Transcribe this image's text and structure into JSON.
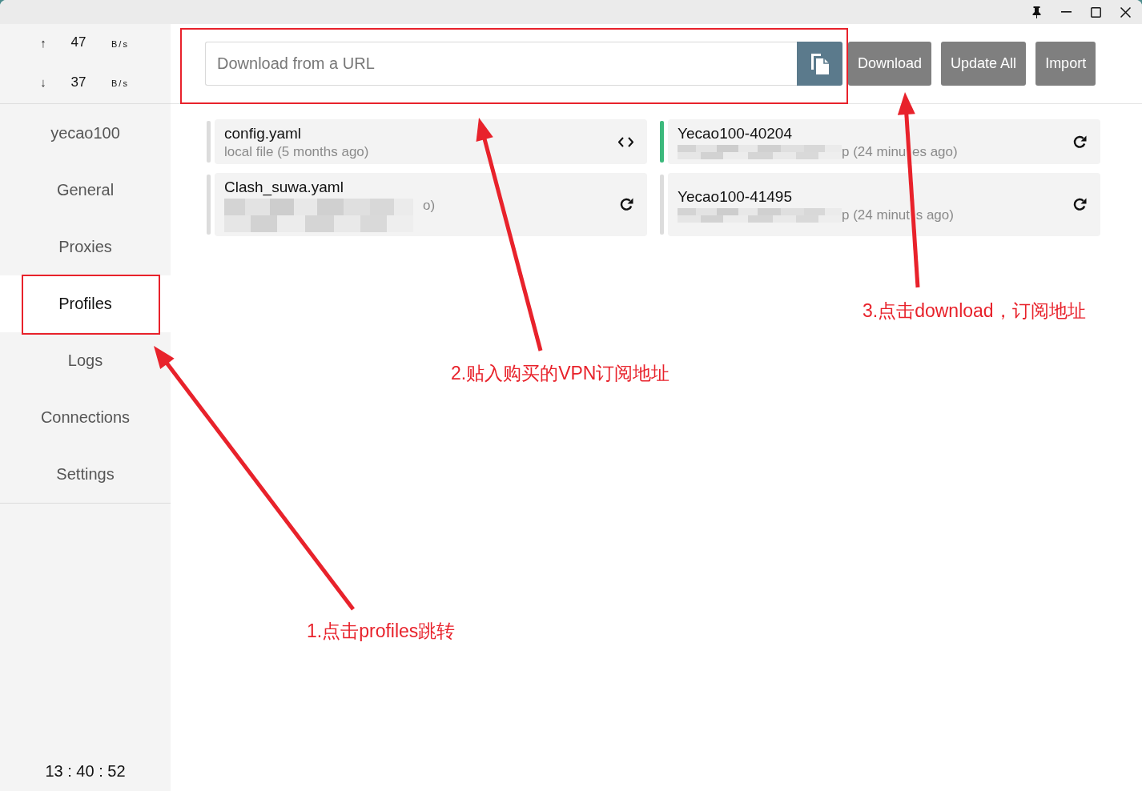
{
  "traffic": [
    {
      "arrow": "↑",
      "value": "47",
      "unit": "B/s"
    },
    {
      "arrow": "↓",
      "value": "37",
      "unit": "B/s"
    }
  ],
  "sidebar": {
    "items": [
      {
        "label": "yecao100",
        "selected": false
      },
      {
        "label": "General",
        "selected": false
      },
      {
        "label": "Proxies",
        "selected": false
      },
      {
        "label": "Profiles",
        "selected": true
      },
      {
        "label": "Logs",
        "selected": false
      },
      {
        "label": "Connections",
        "selected": false
      },
      {
        "label": "Settings",
        "selected": false
      }
    ],
    "clock": "13 : 40 : 52"
  },
  "toolbar": {
    "url_field": {
      "placeholder": "Download from a URL"
    },
    "buttons": [
      "Download",
      "Update All",
      "Import"
    ]
  },
  "profiles": [
    {
      "kind": "local",
      "name": "config.yaml",
      "detail": [
        "local file (5 months ago)"
      ],
      "selected": false
    },
    {
      "kind": "remote",
      "name": "Yecao100-40204",
      "detail": [
        "p (24 minu",
        "es ago)"
      ],
      "selected": true
    },
    {
      "kind": "masked",
      "name": "Clash_suwa.yaml",
      "detail": [
        "o)"
      ],
      "selected": false
    },
    {
      "kind": "remote",
      "name": "Yecao100-41495",
      "detail": [
        "p (24 minut",
        "s ago)"
      ],
      "selected": false
    }
  ],
  "annotations": [
    {
      "text": "1.点击profiles跳转"
    },
    {
      "text": "2.贴入购买的VPN订阅地址"
    },
    {
      "text": "3.点击download，订阅地址"
    }
  ]
}
